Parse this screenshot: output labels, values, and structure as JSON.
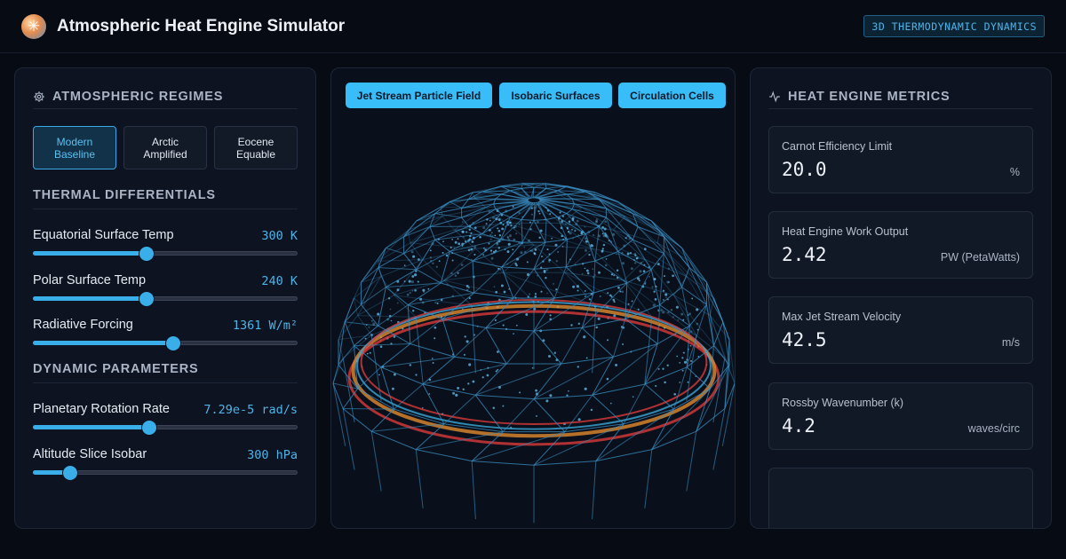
{
  "header": {
    "logo_icon": "snowflake-sun-icon",
    "title": "Atmospheric Heat Engine Simulator",
    "badge": "3D THERMODYNAMIC DYNAMICS"
  },
  "left_panel": {
    "regimes_title": "ATMOSPHERIC REGIMES",
    "regimes_icon": "gear-icon",
    "regimes": [
      {
        "label": "Modern Baseline",
        "active": true
      },
      {
        "label": "Arctic Amplified",
        "active": false
      },
      {
        "label": "Eocene Equable",
        "active": false
      }
    ],
    "thermal_title": "THERMAL DIFFERENTIALS",
    "thermal_sliders": [
      {
        "label": "Equatorial Surface Temp",
        "value": "300 K",
        "level": 0.43
      },
      {
        "label": "Polar Surface Temp",
        "value": "240 K",
        "level": 0.43
      },
      {
        "label": "Radiative Forcing",
        "value": "1361 W/m²",
        "level": 0.53
      }
    ],
    "dynamic_title": "DYNAMIC PARAMETERS",
    "dynamic_sliders": [
      {
        "label": "Planetary Rotation Rate",
        "value": "7.29e-5 rad/s",
        "level": 0.44
      },
      {
        "label": "Altitude Slice Isobar",
        "value": "300 hPa",
        "level": 0.14
      }
    ]
  },
  "center_panel": {
    "view_buttons": [
      {
        "label": "Jet Stream Particle Field"
      },
      {
        "label": "Isobaric Surfaces"
      },
      {
        "label": "Circulation Cells"
      }
    ],
    "colors": {
      "wire": "#3a8fc4",
      "ring_warm": "#e08a2e",
      "ring_hot": "#d93a3a",
      "ring_cool": "#3aa6d6"
    }
  },
  "right_panel": {
    "title": "HEAT ENGINE METRICS",
    "title_icon": "activity-icon",
    "metrics": [
      {
        "label": "Carnot Efficiency Limit",
        "value": "20.0",
        "unit": "%"
      },
      {
        "label": "Heat Engine Work Output",
        "value": "2.42",
        "unit": "PW (PetaWatts)"
      },
      {
        "label": "Max Jet Stream Velocity",
        "value": "42.5",
        "unit": "m/s"
      },
      {
        "label": "Rossby Wavenumber (k)",
        "value": "4.2",
        "unit": "waves/circ"
      }
    ]
  }
}
